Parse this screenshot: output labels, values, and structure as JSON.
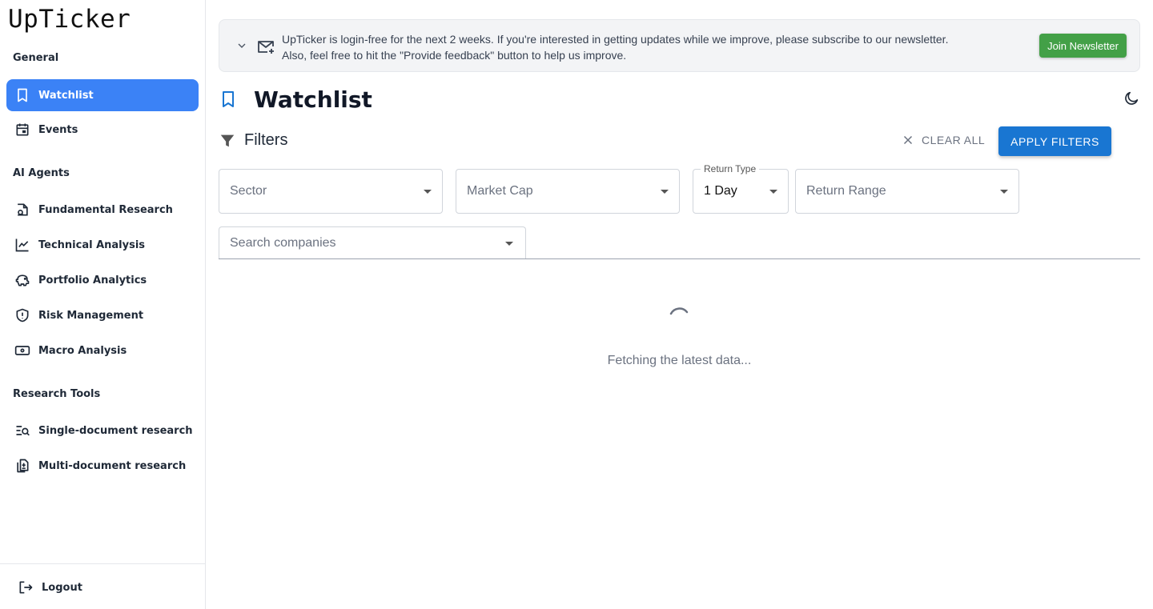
{
  "app": {
    "logo": "UpTicker"
  },
  "sidebar": {
    "sections": [
      {
        "title": "General"
      },
      {
        "title": "AI Agents"
      },
      {
        "title": "Research Tools"
      }
    ],
    "items": [
      {
        "label": "Watchlist",
        "icon": "bookmark-icon",
        "active": true
      },
      {
        "label": "Events",
        "icon": "calendar-icon"
      },
      {
        "label": "Fundamental Research",
        "icon": "document-search-icon"
      },
      {
        "label": "Technical Analysis",
        "icon": "line-chart-icon"
      },
      {
        "label": "Portfolio Analytics",
        "icon": "piggy-bank-icon"
      },
      {
        "label": "Risk Management",
        "icon": "shield-alert-icon"
      },
      {
        "label": "Macro Analysis",
        "icon": "banknote-icon"
      },
      {
        "label": "Single-document research",
        "icon": "text-search-icon"
      },
      {
        "label": "Multi-document research",
        "icon": "files-icon"
      }
    ],
    "logout_label": "Logout"
  },
  "banner": {
    "line1": "UpTicker is login-free for the next 2 weeks. If you're interested in getting updates while we improve, please subscribe to our newsletter.",
    "line2": "Also, feel free to hit the \"Provide feedback\" button to help us improve.",
    "button_label": "Join Newsletter"
  },
  "page": {
    "title": "Watchlist"
  },
  "filters": {
    "label": "Filters",
    "clear_all_label": "CLEAR ALL",
    "apply_label": "APPLY FILTERS",
    "sector_placeholder": "Sector",
    "market_cap_placeholder": "Market Cap",
    "return_type_label": "Return Type",
    "return_type_value": "1 Day",
    "return_range_placeholder": "Return Range",
    "search_placeholder": "Search companies"
  },
  "status": {
    "loading_text": "Fetching the latest data..."
  },
  "colors": {
    "active_nav": "#3b82f6",
    "apply_button": "#1976d2",
    "join_button": "#43a047"
  }
}
